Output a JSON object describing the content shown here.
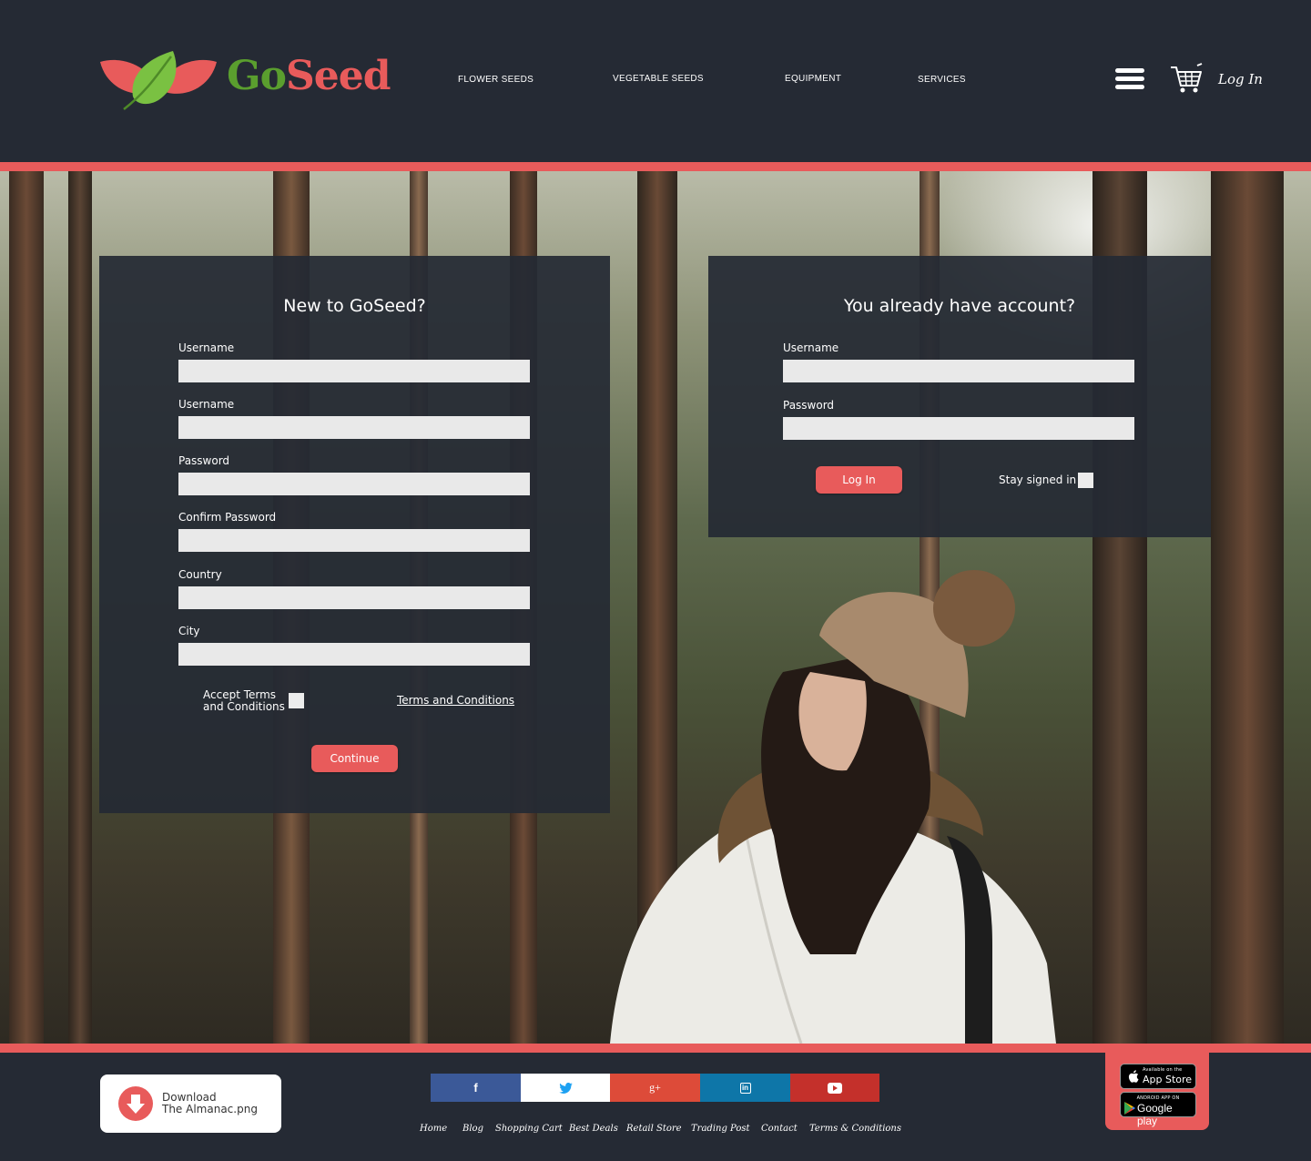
{
  "brand": {
    "name_part1": "Go",
    "name_part2": "Seed"
  },
  "nav": {
    "items": [
      {
        "label": "FLOWER SEEDS"
      },
      {
        "label": "VEGETABLE SEEDS"
      },
      {
        "label": "EQUIPMENT"
      },
      {
        "label": "SERVICES"
      }
    ],
    "menu_icon": "hamburger-icon",
    "cart_icon": "cart-icon",
    "login_label": "Log In"
  },
  "register": {
    "title": "New to GoSeed?",
    "fields": [
      {
        "label": "Username",
        "value": ""
      },
      {
        "label": "Username",
        "value": ""
      },
      {
        "label": "Password",
        "value": ""
      },
      {
        "label": "Confirm Password",
        "value": ""
      },
      {
        "label": "Country",
        "value": ""
      },
      {
        "label": "City",
        "value": ""
      }
    ],
    "accept_line1": "Accept Terms",
    "accept_line2": "and Conditions",
    "terms_link": "Terms and Conditions",
    "continue_label": "Continue"
  },
  "login": {
    "title": "You already have account?",
    "fields": [
      {
        "label": "Username",
        "value": ""
      },
      {
        "label": "Password",
        "value": ""
      }
    ],
    "login_label": "Log In",
    "stay_signed_in": "Stay signed in"
  },
  "footer": {
    "download_line1": "Download",
    "download_line2": "The Almanac.png",
    "social": [
      {
        "name": "facebook",
        "color": "#3b5998"
      },
      {
        "name": "twitter",
        "color": "#ffffff"
      },
      {
        "name": "google-plus",
        "color": "#dd4b39"
      },
      {
        "name": "linkedin",
        "color": "#0e76a8"
      },
      {
        "name": "youtube",
        "color": "#c4302b"
      }
    ],
    "links": [
      {
        "label": "Home"
      },
      {
        "label": "Blog"
      },
      {
        "label": "Shopping Cart"
      },
      {
        "label": "Best Deals"
      },
      {
        "label": "Retail Store"
      },
      {
        "label": "Trading Post"
      },
      {
        "label": "Contact"
      },
      {
        "label": "Terms & Conditions"
      }
    ],
    "app_store_small": "Available on the",
    "app_store_big": "App Store",
    "google_play_small": "ANDROID APP ON",
    "google_play_big": "Google play"
  },
  "colors": {
    "accent": "#e85b5b",
    "dark": "#252a34",
    "leaf_green": "#5a9e2e",
    "input_bg": "#e9e9e9"
  }
}
